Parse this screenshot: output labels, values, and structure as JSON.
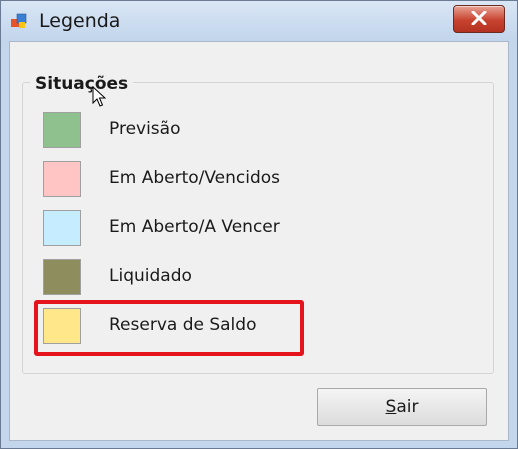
{
  "window": {
    "title": "Legenda",
    "icon": "app-window-icon"
  },
  "titlebar": {
    "close_icon": "close-icon"
  },
  "group": {
    "title": "Situações"
  },
  "legend": {
    "items": [
      {
        "label": "Previsão",
        "color": "#8ec18e"
      },
      {
        "label": "Em Aberto/Vencidos",
        "color": "#ffc5c5"
      },
      {
        "label": "Em Aberto/A Vencer",
        "color": "#c5ecff"
      },
      {
        "label": "Liquidado",
        "color": "#8d8d5e"
      },
      {
        "label": "Reserva de Saldo",
        "color": "#ffe78a"
      }
    ],
    "highlighted_item": "Reserva de Saldo",
    "highlight_color": "#e4131c"
  },
  "buttons": {
    "sair": {
      "label_first": "S",
      "label_rest": "air"
    }
  }
}
